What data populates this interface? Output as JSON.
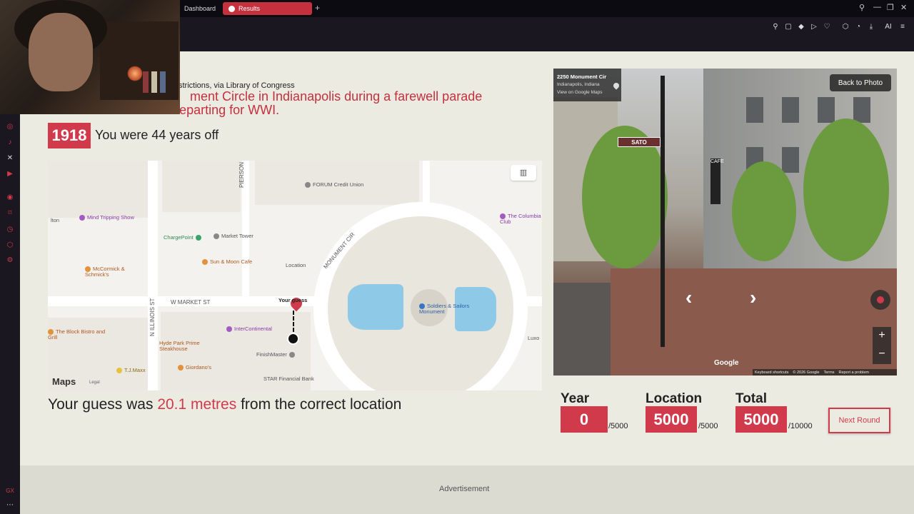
{
  "browser": {
    "tabs": [
      {
        "label": "Dashboard"
      },
      {
        "label": "Results"
      }
    ],
    "new_tab_glyph": "+",
    "window_buttons": [
      "—",
      "❐",
      "✕"
    ],
    "toolbar_ai_label": "AI"
  },
  "sidebar": {
    "icons": [
      "instagram-icon",
      "tiktok-icon",
      "x-twitter-icon",
      "youtube-icon",
      "player-icon",
      "bookmark-icon",
      "history-icon",
      "extensions-icon",
      "settings-icon"
    ],
    "bottom_label": "GX"
  },
  "result": {
    "credit": "strictions, via Library of Congress",
    "caption_line1": "ment Circle in Indianapolis during a farewell parade",
    "caption_line2": "for American soldiers departing for WWI.",
    "year": "1918",
    "years_off": "You were 44 years off",
    "distance_prefix": "Your guess was",
    "distance_value": "20.1 metres",
    "distance_suffix": "from the correct location"
  },
  "map": {
    "streets": [
      "PIERSON",
      "N ILLINOIS ST",
      "W MARKET ST",
      "MONUMENT CIR"
    ],
    "pois": {
      "forum": "FORUM Credit Union",
      "mind": "Mind Tripping Show",
      "chargepoint": "ChargePoint",
      "market_tower": "Market Tower",
      "sunmoon": "Sun & Moon Cafe",
      "mccormick": "McCormick & Schmick's",
      "columbia": "The Columbia Club",
      "soldiers": "Soldiers & Sailors Monument",
      "block_bistro": "The Block Bistro and Grill",
      "intercontinental": "InterContinental",
      "hyde_park": "Hyde Park Prime Steakhouse",
      "finishmaster": "FinishMaster",
      "giordano": "Giordano's",
      "tjmaxx": "T.J.Maxx",
      "star": "STAR Financial Bank",
      "luxo": "Luxo",
      "lton": "lton"
    },
    "location_label": "Location",
    "guess_label": "Your guess",
    "maps_brand": "Maps",
    "legal": "Legal"
  },
  "streetview": {
    "address": "2250 Monument Cir",
    "city": "Indianapolis, Indiana",
    "link": "View on Google Maps",
    "back_button": "Back to Photo",
    "sign": "SATO",
    "cafe_sign": "CAFE",
    "google": "Google",
    "footer": [
      "Keyboard shortcuts",
      "© 2026 Google",
      "Terms",
      "Report a problem"
    ]
  },
  "scores": {
    "year_label": "Year",
    "year_value": "0",
    "year_max": "/5000",
    "location_label": "Location",
    "location_value": "5000",
    "location_max": "/5000",
    "total_label": "Total",
    "total_value": "5000",
    "total_max": "/10000",
    "next_button": "Next Round"
  },
  "ad": {
    "label": "Advertisement"
  },
  "colors": {
    "accent": "#d13a4a",
    "page_bg": "#ecebe2",
    "map_water": "#8ecae8"
  }
}
